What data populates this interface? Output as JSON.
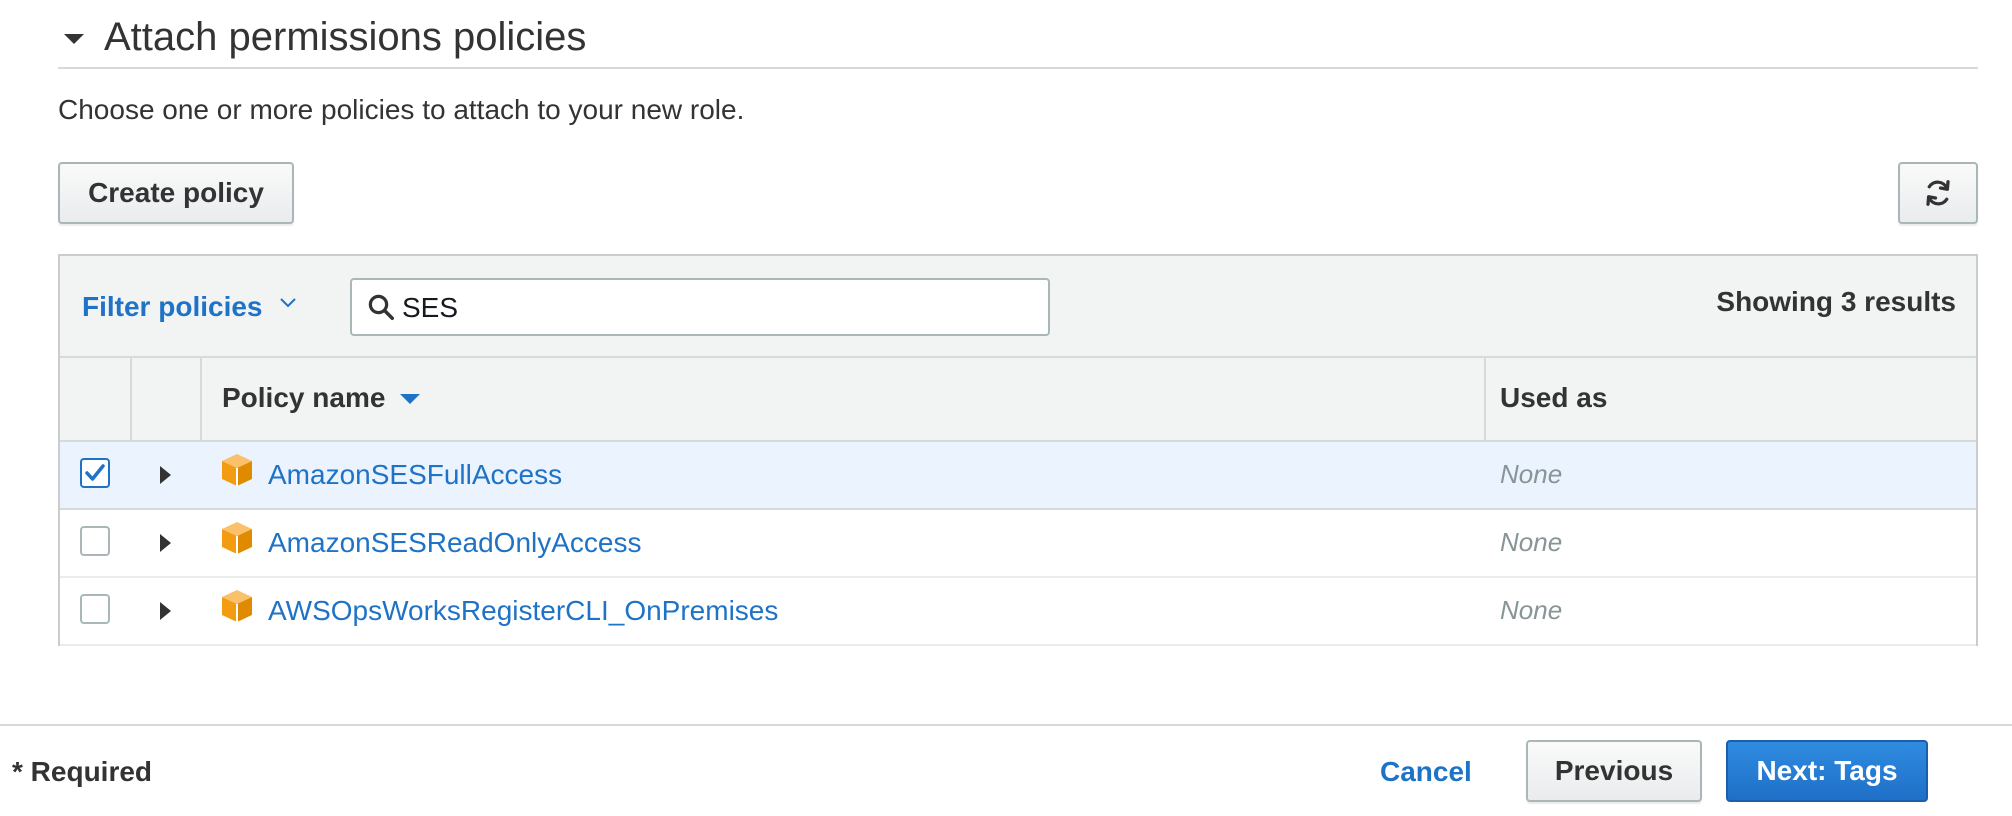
{
  "section": {
    "title": "Attach permissions policies",
    "subtitle": "Choose one or more policies to attach to your new role."
  },
  "toolbar": {
    "create_policy_label": "Create policy",
    "refresh_icon": "refresh-icon"
  },
  "filter": {
    "label": "Filter policies",
    "search_value": "SES",
    "results_text": "Showing 3 results"
  },
  "table": {
    "columns": {
      "policy_name": "Policy name",
      "used_as": "Used as"
    },
    "rows": [
      {
        "checked": true,
        "name": "AmazonSESFullAccess",
        "used_as": "None"
      },
      {
        "checked": false,
        "name": "AmazonSESReadOnlyAccess",
        "used_as": "None"
      },
      {
        "checked": false,
        "name": "AWSOpsWorksRegisterCLI_OnPremises",
        "used_as": "None"
      }
    ]
  },
  "footer": {
    "required_label": "* Required",
    "cancel_label": "Cancel",
    "previous_label": "Previous",
    "next_label": "Next: Tags"
  },
  "colors": {
    "link_blue": "#1f73c7",
    "primary_button": "#1f6fc7",
    "selected_row": "#eaf3fe",
    "policy_icon_orange": "#f39c12"
  }
}
